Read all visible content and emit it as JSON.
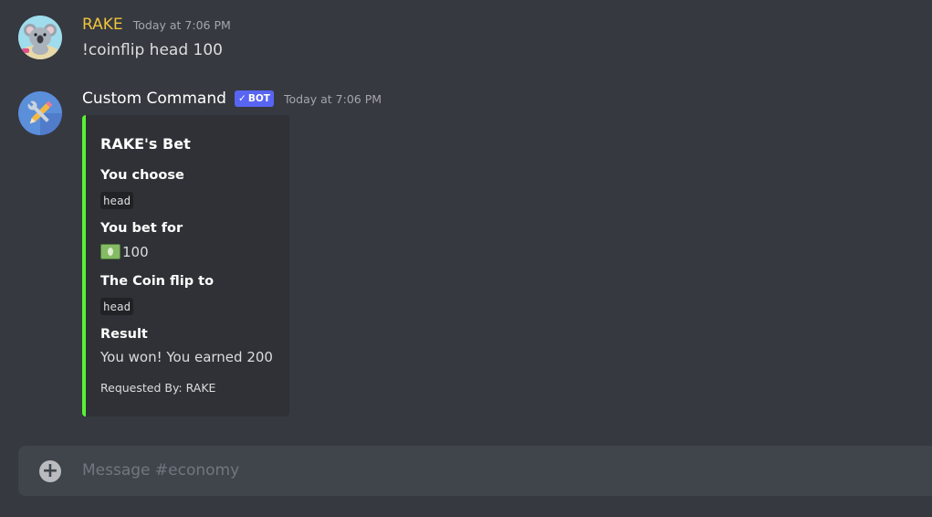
{
  "channel": {
    "composer_placeholder": "Message #economy"
  },
  "messages": [
    {
      "username": "RAKE",
      "timestamp": "Today at 7:06 PM",
      "content": "!coinflip head 100",
      "avatar_icon": "koala-avatar",
      "name_color": "#f0c33c"
    },
    {
      "username": "Custom Command",
      "bot_tag": "BOT",
      "bot_check": "✓",
      "timestamp": "Today at 7:06 PM",
      "avatar_icon": "tools-avatar",
      "embed": {
        "color": "#57f236",
        "title": "RAKE's Bet",
        "fields": [
          {
            "name": "You choose",
            "value": "head"
          },
          {
            "name": "You bet for",
            "value": "100",
            "icon": "dollar-bill-icon"
          },
          {
            "name": "The Coin flip to",
            "value": "head"
          },
          {
            "name": "Result",
            "value": "You won! You earned 200"
          }
        ],
        "footer": "Requested By: RAKE"
      }
    }
  ]
}
